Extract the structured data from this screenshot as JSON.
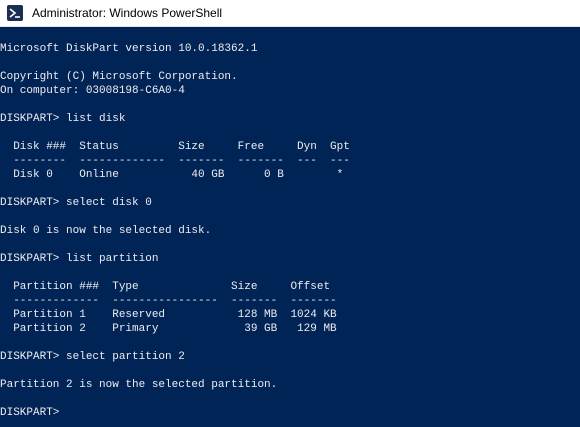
{
  "window": {
    "title": "Administrator: Windows PowerShell"
  },
  "console": {
    "lines": [
      "Microsoft DiskPart version 10.0.18362.1",
      "",
      "Copyright (C) Microsoft Corporation.",
      "On computer: 03008198-C6A0-4",
      "",
      "DISKPART> list disk",
      "",
      "  Disk ###  Status         Size     Free     Dyn  Gpt",
      "  --------  -------------  -------  -------  ---  ---",
      "  Disk 0    Online           40 GB      0 B        *",
      "",
      "DISKPART> select disk 0",
      "",
      "Disk 0 is now the selected disk.",
      "",
      "DISKPART> list partition",
      "",
      "  Partition ###  Type              Size     Offset",
      "  -------------  ----------------  -------  -------",
      "  Partition 1    Reserved           128 MB  1024 KB",
      "  Partition 2    Primary             39 GB   129 MB",
      "",
      "DISKPART> select partition 2",
      "",
      "Partition 2 is now the selected partition.",
      "",
      "DISKPART>"
    ]
  }
}
